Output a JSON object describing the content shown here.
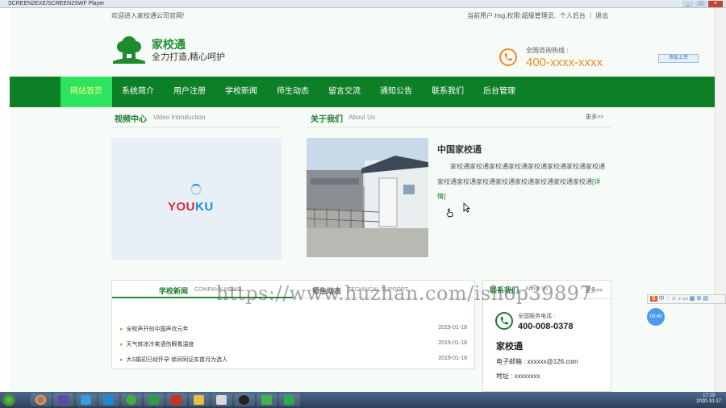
{
  "window": {
    "title": "SCREEN2EXE/SCREEN2SWF Player",
    "controls": [
      "_",
      "□",
      "×"
    ]
  },
  "topbar": {
    "welcome": "欢迎进入家校通公司官网!",
    "user_text": "当前用户:hsg,权限:超级管理员,",
    "personal_center": "个人后台",
    "separator": "|",
    "logout": "退出"
  },
  "header": {
    "site_name": "家校通",
    "slogan": "全力打造,精心呵护",
    "hotline_label": "全国咨询热线 :",
    "hotline_number": "400-xxxx-xxxx",
    "upload_button": "添加上传"
  },
  "nav": {
    "items": [
      {
        "label": "网站首页",
        "active": true
      },
      {
        "label": "系统简介",
        "active": false
      },
      {
        "label": "用户注册",
        "active": false
      },
      {
        "label": "学校新闻",
        "active": false
      },
      {
        "label": "师生动态",
        "active": false
      },
      {
        "label": "留言交流",
        "active": false
      },
      {
        "label": "通知公告",
        "active": false
      },
      {
        "label": "联系我们",
        "active": false
      },
      {
        "label": "后台管理",
        "active": false
      }
    ]
  },
  "video": {
    "title": "视频中心",
    "subtitle": "Video Introduction",
    "player_brand_red": "YOU",
    "player_brand_blue": "KU"
  },
  "about": {
    "title": "关于我们",
    "subtitle": "About Us",
    "more": "更多>>",
    "company_name": "中国家校通",
    "description": "家校通家校通家校通家校通家校通家校通家校通家校通家校通家校通家校通家校通家校通家校通家校通家校通",
    "detail_link": "[详情]"
  },
  "news": {
    "tab_active_cn": "学校新闻",
    "tab_active_en": "COMPANY NEWS",
    "tab_other_cn": "师生动态",
    "tab_other_en": "TECHNICAL SUPPORT",
    "items": [
      {
        "title": "全校声开创中国声优元年",
        "date": "2019-01-18"
      },
      {
        "title": "天气转凉冷笑语伤眼看温度",
        "date": "2019-01-18"
      },
      {
        "title": "大S婚初已经怀孕 徐同同证实苗月为选人",
        "date": "2019-01-18"
      }
    ]
  },
  "contact": {
    "title": "联系我们",
    "subtitle": "About Us",
    "more": "更多>>",
    "phone_label": "全国服务电话 :",
    "phone_number": "400-008-0378",
    "name": "家校通",
    "email": "电子邮箱 : xxxxxx@126.com",
    "address": "地址 : xxxxxxxx"
  },
  "watermark": "https://www.huzhan.com/ishop39897",
  "ime": {
    "label": "中",
    "logo": "S"
  },
  "bubble": "00:40",
  "clock": {
    "time": "17:29",
    "date": "2020-10-17"
  },
  "colors": {
    "nav": "#0d7f27",
    "nav_active": "#2ee360",
    "accent": "#1e8c2e",
    "hotline": "#f08a24"
  }
}
